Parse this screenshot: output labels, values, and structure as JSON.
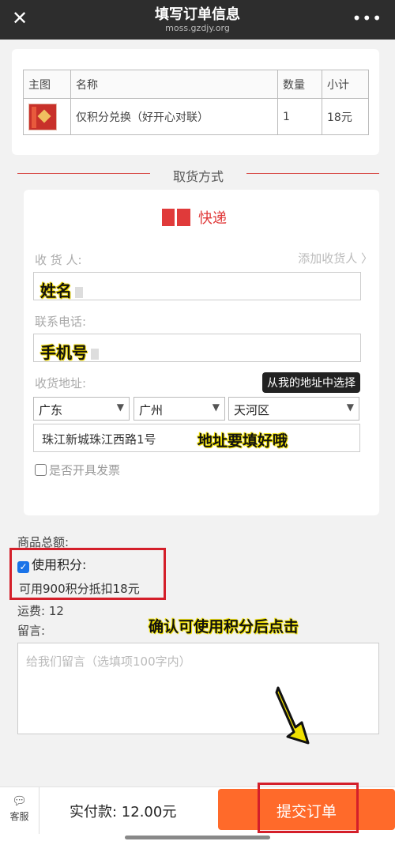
{
  "topbar": {
    "title": "填写订单信息",
    "url": "moss.gzdjy.org",
    "close_icon": "close-icon",
    "more_icon": "more-icon"
  },
  "product_table": {
    "headers": [
      "主图",
      "名称",
      "数量",
      "小计"
    ],
    "row": {
      "name": "仅积分兑换（好开心对联）",
      "qty": "1",
      "subtotal": "18元"
    }
  },
  "section_title": "取货方式",
  "delivery": {
    "method_label": "快递",
    "receiver_label": "收 货 人:",
    "add_receiver": "添加收货人 〉",
    "receiver_value": "姓名",
    "phone_label": "联系电话:",
    "phone_value": "手机号",
    "address_label": "收货地址:",
    "pick_address": "从我的地址中选择",
    "province": "广东",
    "city": "广州",
    "district": "天河区",
    "street": "珠江新城珠江西路1号",
    "street_note": "地址要填好哦",
    "invoice_label": "是否开具发票"
  },
  "summary": {
    "total_label": "商品总额:",
    "use_points_label": "使用积分:",
    "points_avail": "可用900积分抵扣18元",
    "shipping": "运费: 12",
    "message_label": "留言:",
    "message_placeholder": "给我们留言（选填项100字内）",
    "confirm_note": "确认可使用积分后点击"
  },
  "bottombar": {
    "service_label": "客服",
    "pay_label": "实付款: 12.00元",
    "submit_label": "提交订单"
  },
  "colors": {
    "accent": "#ff6a2a",
    "highlight": "#d41f2a",
    "express": "#e03a3a"
  }
}
